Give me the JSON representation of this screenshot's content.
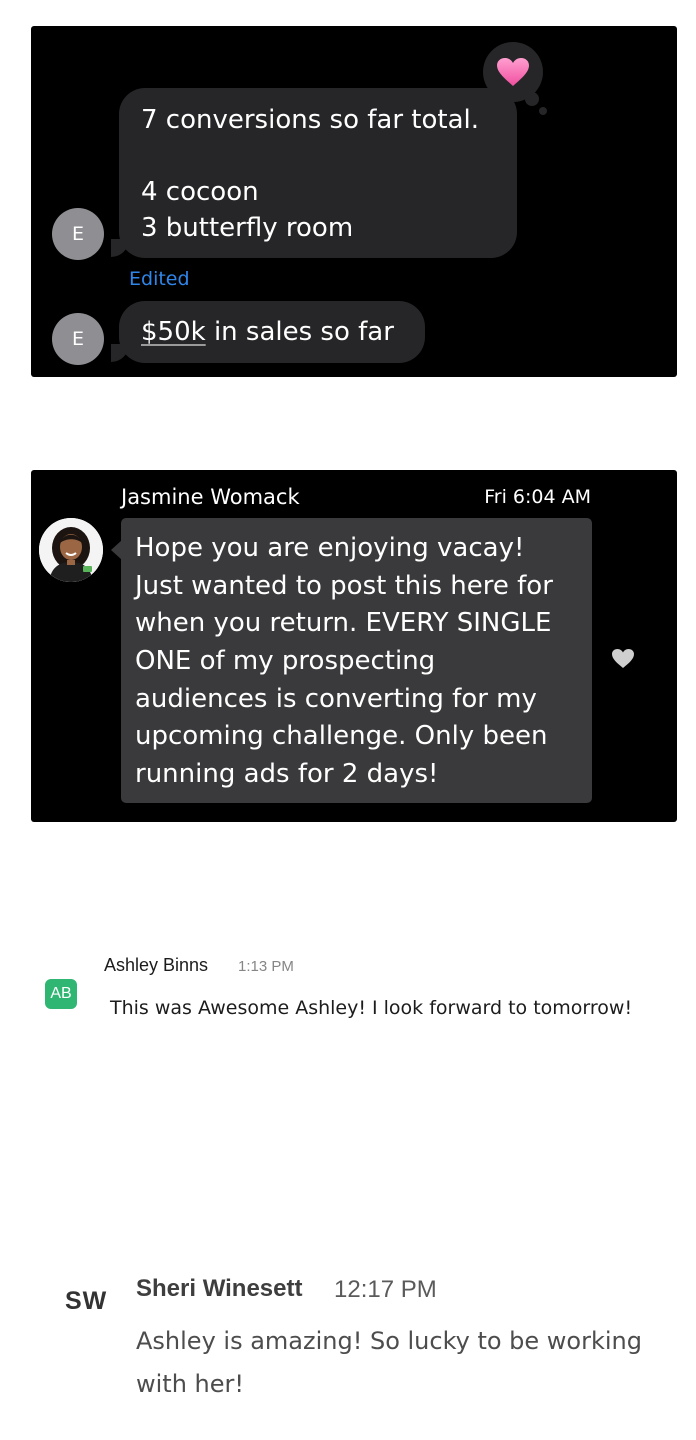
{
  "imessage": {
    "message1_lines": [
      "7 conversions so far total.",
      "",
      "4 cocoon",
      "3 butterfly room"
    ],
    "edited_label": "Edited",
    "message2_amount": "$50k",
    "message2_rest": " in sales so far",
    "avatar_initial": "E",
    "reaction": "heart"
  },
  "jasmine": {
    "name": "Jasmine Womack",
    "time": "Fri 6:04 AM",
    "message_lines": [
      "Hope you are enjoying vacay!",
      "Just wanted to post this here for",
      "when you return. EVERY SINGLE",
      "ONE of my prospecting",
      "audiences is converting for my",
      "upcoming challenge. Only been",
      "running ads for 2 days!"
    ]
  },
  "ashley": {
    "initials": "AB",
    "name": "Ashley Binns",
    "time": "1:13 PM",
    "message": "This was Awesome Ashley! I look forward to tomorrow!",
    "avatar_color": "#2fb673"
  },
  "sheri": {
    "initials": "SW",
    "name": "Sheri Winesett",
    "time": "12:17 PM",
    "message": "Ashley is amazing! So lucky to be working with her!"
  },
  "colors": {
    "imessage_bubble": "#262628",
    "edited_blue": "#2f86ea",
    "heart_pink": "#ff6fb5"
  }
}
